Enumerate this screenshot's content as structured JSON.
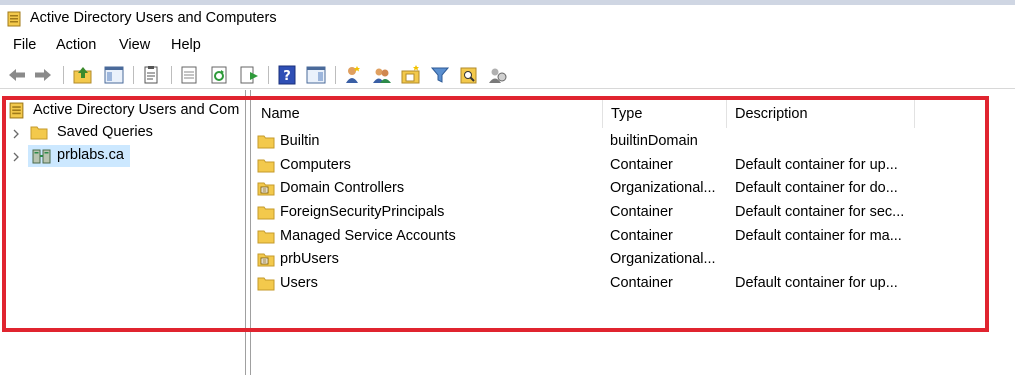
{
  "window": {
    "title": "Active Directory Users and Computers"
  },
  "menu": [
    "File",
    "Action",
    "View",
    "Help"
  ],
  "toolbar": {
    "buttons": [
      "back-icon",
      "forward-icon",
      "up-folder-icon",
      "show-console-tree-icon",
      "delete-icon",
      "properties-icon",
      "refresh-icon",
      "export-list-icon",
      "help-icon",
      "show-action-pane-icon",
      "new-user-icon",
      "new-group-icon",
      "new-ou-icon",
      "filter-icon",
      "find-icon",
      "delegate-control-icon"
    ]
  },
  "tree": {
    "root_label": "Active Directory Users and Com",
    "items": [
      {
        "label": "Saved Queries",
        "icon": "folder-icon"
      },
      {
        "label": "prblabs.ca",
        "icon": "domain-icon",
        "selected": true
      }
    ]
  },
  "list": {
    "columns": [
      "Name",
      "Type",
      "Description"
    ],
    "rows": [
      {
        "name": "Builtin",
        "type": "builtinDomain",
        "description": "",
        "icon": "folder-icon"
      },
      {
        "name": "Computers",
        "type": "Container",
        "description": "Default container for up...",
        "icon": "folder-icon"
      },
      {
        "name": "Domain Controllers",
        "type": "Organizational...",
        "description": "Default container for do...",
        "icon": "ou-icon"
      },
      {
        "name": "ForeignSecurityPrincipals",
        "type": "Container",
        "description": "Default container for sec...",
        "icon": "folder-icon"
      },
      {
        "name": "Managed Service Accounts",
        "type": "Container",
        "description": "Default container for ma...",
        "icon": "folder-icon"
      },
      {
        "name": "prbUsers",
        "type": "Organizational...",
        "description": "",
        "icon": "ou-icon"
      },
      {
        "name": "Users",
        "type": "Container",
        "description": "Default container for up...",
        "icon": "folder-icon"
      }
    ]
  },
  "colors": {
    "highlight_border": "#e0242f",
    "selection": "#cce8ff",
    "folder": "#f3c94c"
  }
}
